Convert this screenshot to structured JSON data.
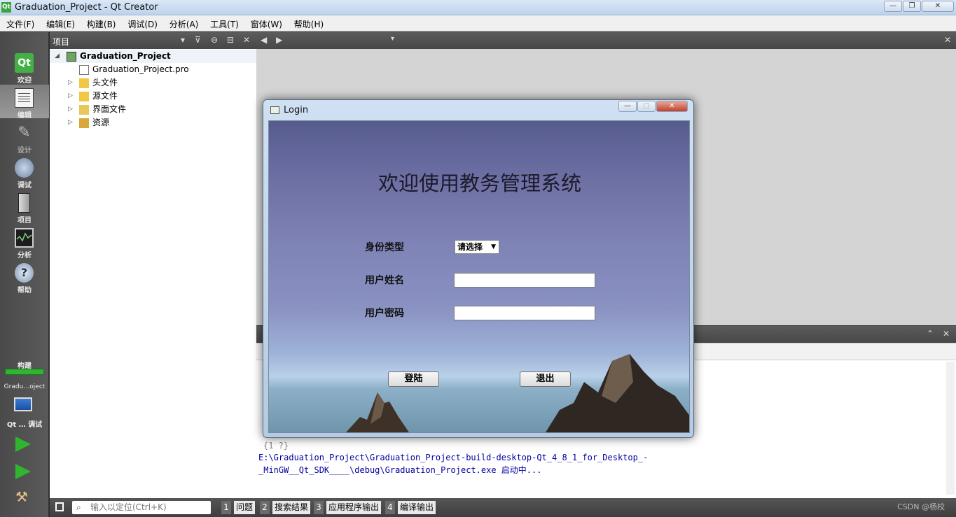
{
  "window": {
    "title": "Graduation_Project - Qt Creator",
    "app_icon": "Qt"
  },
  "menubar": [
    "文件(F)",
    "编辑(E)",
    "构建(B)",
    "调试(D)",
    "分析(A)",
    "工具(T)",
    "窗体(W)",
    "帮助(H)"
  ],
  "modes": [
    {
      "label": "欢迎",
      "icon": "qt-logo-icon"
    },
    {
      "label": "编辑",
      "icon": "edit-document-icon"
    },
    {
      "label": "设计",
      "icon": "design-pencil-icon"
    },
    {
      "label": "调试",
      "icon": "debug-bug-icon"
    },
    {
      "label": "项目",
      "icon": "project-book-icon"
    },
    {
      "label": "分析",
      "icon": "analyze-scope-icon"
    },
    {
      "label": "帮助",
      "icon": "help-question-icon"
    }
  ],
  "build_panel": {
    "label": "构建",
    "project": "Gradu…oject",
    "target_label": "Qt … 调试"
  },
  "project_panel": {
    "header": "项目",
    "root": "Graduation_Project",
    "items": [
      {
        "label": "Graduation_Project.pro",
        "icon": "pro-file-icon"
      },
      {
        "label": "头文件",
        "icon": "header-folder-icon"
      },
      {
        "label": "源文件",
        "icon": "source-folder-icon"
      },
      {
        "label": "界面文件",
        "icon": "form-folder-icon"
      },
      {
        "label": "资源",
        "icon": "resource-folder-icon"
      }
    ]
  },
  "output": {
    "lines": [
      "{1 ?}",
      "E:\\Graduation_Project\\Graduation_Project-build-desktop-Qt_4_8_1_for_Desktop_-",
      "_MinGW__Qt_SDK____\\debug\\Graduation_Project.exe 启动中..."
    ]
  },
  "statusbar": {
    "locate_placeholder": "输入以定位(Ctrl+K)",
    "tabs": [
      {
        "num": "1",
        "label": "问题"
      },
      {
        "num": "2",
        "label": "搜索结果"
      },
      {
        "num": "3",
        "label": "应用程序输出"
      },
      {
        "num": "4",
        "label": "编译输出"
      }
    ]
  },
  "login": {
    "window_title": "Login",
    "heading": "欢迎使用教务管理系统",
    "type_label": "身份类型",
    "type_select": "请选择",
    "username_label": "用户姓名",
    "password_label": "用户密码",
    "login_button": "登陆",
    "exit_button": "退出"
  },
  "watermark": "CSDN @杨校",
  "colors": {
    "accent_green": "#2fb52f",
    "dialog_frame": "#b4cbe3",
    "output_text": "#0000a0"
  }
}
